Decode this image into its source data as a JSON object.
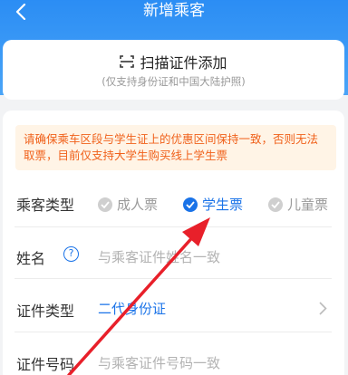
{
  "header": {
    "title": "新增乘客",
    "back_icon": "back-arrow-icon",
    "color": "#2b8df4"
  },
  "scan": {
    "label": "扫描证件添加",
    "note": "(仅支持身份证和中国大陆护照)",
    "icon": "scan-icon"
  },
  "notice": {
    "text": "请确保乘车区段与学生证上的优惠区间保持一致，否则无法取票，目前仅支持大学生购买线上学生票",
    "color": "#f0611b"
  },
  "passenger_type": {
    "label": "乘客类型",
    "options": [
      {
        "label": "成人票",
        "selected": false
      },
      {
        "label": "学生票",
        "selected": true
      },
      {
        "label": "儿童票",
        "selected": false
      }
    ]
  },
  "name": {
    "label": "姓名",
    "placeholder": "与乘客证件姓名一致",
    "help_icon": "question-icon"
  },
  "id_type": {
    "label": "证件类型",
    "value": "二代身份证",
    "icon": "chevron-right-icon"
  },
  "id_number": {
    "label": "证件号码",
    "placeholder": "与乘客证件号码一致"
  },
  "accent_color": "#1a73e8"
}
